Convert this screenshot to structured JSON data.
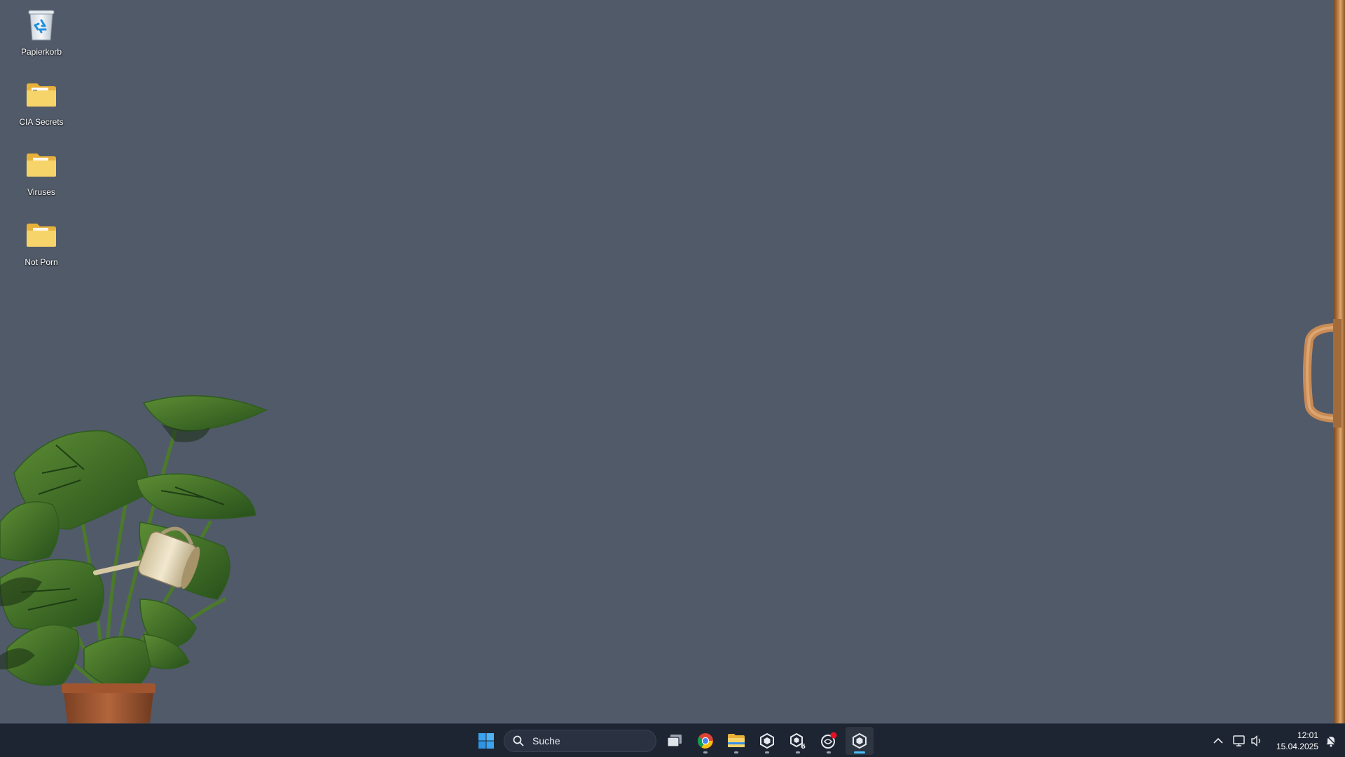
{
  "desktop": {
    "background_color": "#515a69",
    "icons": [
      {
        "label": "Papierkorb",
        "icon": "recycle-bin-icon"
      },
      {
        "label": "CIA Secrets",
        "icon": "folder-icon"
      },
      {
        "label": "Viruses",
        "icon": "folder-icon"
      },
      {
        "label": "Not Porn",
        "icon": "folder-icon"
      }
    ]
  },
  "taskbar": {
    "background_color": "#1d2532",
    "search": {
      "placeholder": "Suche"
    },
    "apps": [
      {
        "name": "start-button",
        "icon": "windows-logo-icon"
      },
      {
        "name": "task-view",
        "icon": "task-view-icon"
      },
      {
        "name": "chrome",
        "icon": "chrome-icon",
        "running": true
      },
      {
        "name": "file-explorer",
        "icon": "folder-icon",
        "running": true
      },
      {
        "name": "unity-hub",
        "icon": "unity-icon",
        "running": true
      },
      {
        "name": "unity-6",
        "icon": "unity-6-icon",
        "running": true
      },
      {
        "name": "app-with-notification",
        "icon": "circular-app-icon",
        "running": true
      },
      {
        "name": "unity-editor",
        "icon": "unity-icon",
        "running": true,
        "active": true
      }
    ],
    "tray": {
      "time": "12:01",
      "date": "15.04.2025"
    }
  }
}
